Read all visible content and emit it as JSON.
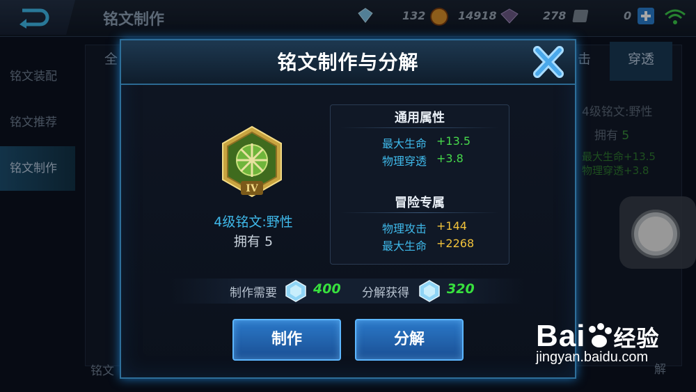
{
  "screen": {
    "title": "铭文制作",
    "resources": [
      "132",
      "14918",
      "278",
      "0"
    ],
    "sidebar": [
      "铭文装配",
      "铭文推荐",
      "铭文制作"
    ],
    "bg_tabs": [
      "全",
      "击",
      "穿透"
    ],
    "bg_preview": {
      "name": "4级铭文:野性",
      "own_label": "拥有",
      "own_count": "5",
      "stat1": "最大生命+13.5",
      "stat2": "物理穿透+3.8"
    },
    "bg_bottom_left": "铭文",
    "bg_bottom_right": "解"
  },
  "dialog": {
    "title": "铭文制作与分解",
    "rune": {
      "level_numeral": "IV",
      "name": "4级铭文:野性",
      "own_label": "拥有",
      "own_count": "5"
    },
    "general_header": "通用属性",
    "general_stats": [
      {
        "name": "最大生命",
        "value": "+13.5"
      },
      {
        "name": "物理穿透",
        "value": "+3.8"
      }
    ],
    "adventure_header": "冒险专属",
    "adventure_stats": [
      {
        "name": "物理攻击",
        "value": "+144"
      },
      {
        "name": "最大生命",
        "value": "+2268"
      }
    ],
    "craft_cost_label": "制作需要",
    "craft_cost": "400",
    "decompose_gain_label": "分解获得",
    "decompose_gain": "320",
    "craft_button": "制作",
    "decompose_button": "分解"
  },
  "watermark": {
    "brand": "Bai",
    "brand_cn": "经验",
    "url": "jingyan.baidu.com"
  },
  "colors": {
    "accent_blue": "#3fb9ea",
    "value_green": "#47d94b",
    "value_yellow": "#f2c33b",
    "button_blue": "#2b79c9"
  }
}
